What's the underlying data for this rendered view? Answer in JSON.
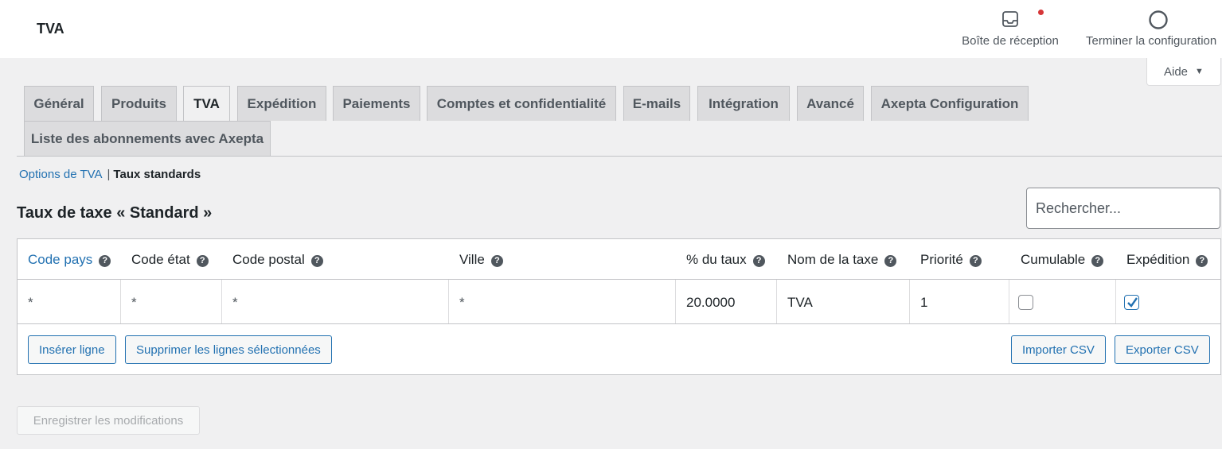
{
  "header": {
    "title": "TVA",
    "inbox_label": "Boîte de réception",
    "setup_label": "Terminer la configuration",
    "notification_color": "#d63638",
    "help_label": "Aide"
  },
  "tabs": [
    {
      "label": "Général"
    },
    {
      "label": "Produits"
    },
    {
      "label": "TVA",
      "active": true
    },
    {
      "label": "Expédition"
    },
    {
      "label": "Paiements"
    },
    {
      "label": "Comptes et confidentialité"
    },
    {
      "label": "E-mails"
    },
    {
      "label": "Intégration"
    },
    {
      "label": "Avancé"
    },
    {
      "label": "Axepta Configuration"
    },
    {
      "label": "Liste des abonnements avec Axepta"
    }
  ],
  "subnav": {
    "link": "Options de TVA",
    "separator": "|",
    "current": "Taux standards"
  },
  "section_title": "Taux de taxe « Standard »",
  "search": {
    "placeholder": "Rechercher...",
    "value": ""
  },
  "table": {
    "columns": [
      "Code pays",
      "Code état",
      "Code postal",
      "Ville",
      "% du taux",
      "Nom de la taxe",
      "Priorité",
      "Cumulable",
      "Expédition"
    ],
    "help_glyph": "?",
    "rows": [
      {
        "country": "*",
        "state": "*",
        "postcode": "*",
        "city": "*",
        "rate": "20.0000",
        "name": "TVA",
        "priority": "1",
        "compound": false,
        "shipping": true
      }
    ]
  },
  "buttons": {
    "insert": "Insérer ligne",
    "remove": "Supprimer les lignes sélectionnées",
    "import": "Importer CSV",
    "export": "Exporter CSV",
    "save": "Enregistrer les modifications"
  },
  "colors": {
    "accent": "#2271b1",
    "background": "#f0f0f1"
  }
}
